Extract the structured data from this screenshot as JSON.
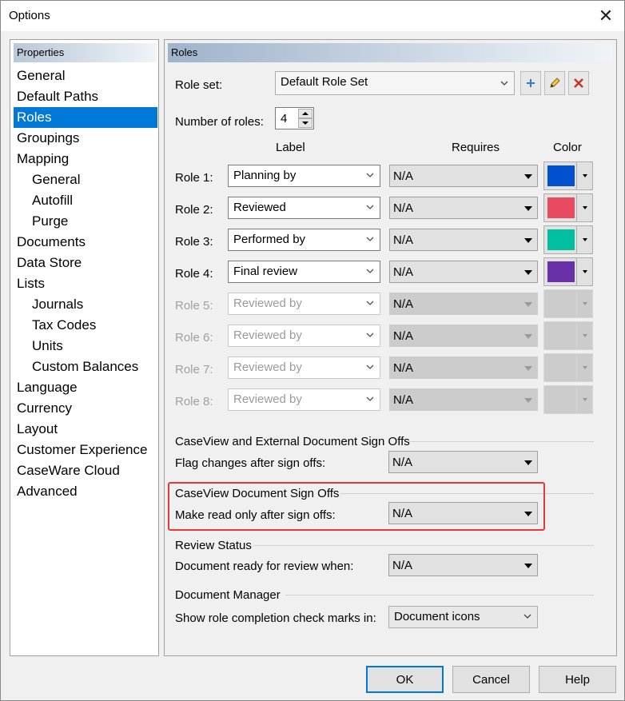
{
  "window": {
    "title": "Options",
    "close_glyph": "✕"
  },
  "left": {
    "header": "Properties",
    "items": [
      {
        "label": "General",
        "sub": false,
        "selected": false
      },
      {
        "label": "Default Paths",
        "sub": false,
        "selected": false
      },
      {
        "label": "Roles",
        "sub": false,
        "selected": true
      },
      {
        "label": "Groupings",
        "sub": false,
        "selected": false
      },
      {
        "label": "Mapping",
        "sub": false,
        "selected": false
      },
      {
        "label": "General",
        "sub": true,
        "selected": false
      },
      {
        "label": "Autofill",
        "sub": true,
        "selected": false
      },
      {
        "label": "Purge",
        "sub": true,
        "selected": false
      },
      {
        "label": "Documents",
        "sub": false,
        "selected": false
      },
      {
        "label": "Data Store",
        "sub": false,
        "selected": false
      },
      {
        "label": "Lists",
        "sub": false,
        "selected": false
      },
      {
        "label": "Journals",
        "sub": true,
        "selected": false
      },
      {
        "label": "Tax Codes",
        "sub": true,
        "selected": false
      },
      {
        "label": "Units",
        "sub": true,
        "selected": false
      },
      {
        "label": "Custom Balances",
        "sub": true,
        "selected": false
      },
      {
        "label": "Language",
        "sub": false,
        "selected": false
      },
      {
        "label": "Currency",
        "sub": false,
        "selected": false
      },
      {
        "label": "Layout",
        "sub": false,
        "selected": false
      },
      {
        "label": "Customer Experience",
        "sub": false,
        "selected": false
      },
      {
        "label": "CaseWare Cloud",
        "sub": false,
        "selected": false
      },
      {
        "label": "Advanced",
        "sub": false,
        "selected": false
      }
    ]
  },
  "roles": {
    "header": "Roles",
    "role_set_label": "Role set:",
    "role_set_value": "Default Role Set",
    "num_roles_label": "Number of roles:",
    "num_roles_value": "4",
    "col_label": "Label",
    "col_requires": "Requires",
    "col_color": "Color",
    "rows": [
      {
        "name": "Role 1:",
        "label": "Planning by",
        "requires": "N/A",
        "color": "#0050d0",
        "enabled": true
      },
      {
        "name": "Role 2:",
        "label": "Reviewed",
        "requires": "N/A",
        "color": "#e84a5f",
        "enabled": true
      },
      {
        "name": "Role 3:",
        "label": "Performed by",
        "requires": "N/A",
        "color": "#00bfa0",
        "enabled": true
      },
      {
        "name": "Role 4:",
        "label": "Final review",
        "requires": "N/A",
        "color": "#6a30a8",
        "enabled": true
      },
      {
        "name": "Role 5:",
        "label": "Reviewed by",
        "requires": "N/A",
        "color": "",
        "enabled": false
      },
      {
        "name": "Role 6:",
        "label": "Reviewed by",
        "requires": "N/A",
        "color": "",
        "enabled": false
      },
      {
        "name": "Role 7:",
        "label": "Reviewed by",
        "requires": "N/A",
        "color": "",
        "enabled": false
      },
      {
        "name": "Role 8:",
        "label": "Reviewed by",
        "requires": "N/A",
        "color": "",
        "enabled": false
      }
    ],
    "external": {
      "heading": "CaseView and External Document Sign Offs",
      "label": "Flag changes after sign offs:",
      "value": "N/A"
    },
    "caseview": {
      "heading": "CaseView Document Sign Offs",
      "label": "Make read only after sign offs:",
      "value": "N/A"
    },
    "review": {
      "heading": "Review Status",
      "label": "Document ready for review when:",
      "value": "N/A"
    },
    "manager": {
      "heading": "Document Manager",
      "label": "Show role completion check marks in:",
      "value": "Document icons"
    }
  },
  "buttons": {
    "ok": "OK",
    "cancel": "Cancel",
    "help": "Help"
  },
  "colors": {
    "selection": "#0078d7",
    "highlight_border": "#e53935",
    "add_icon": "#3a78d8",
    "delete_icon": "#c0392b"
  }
}
